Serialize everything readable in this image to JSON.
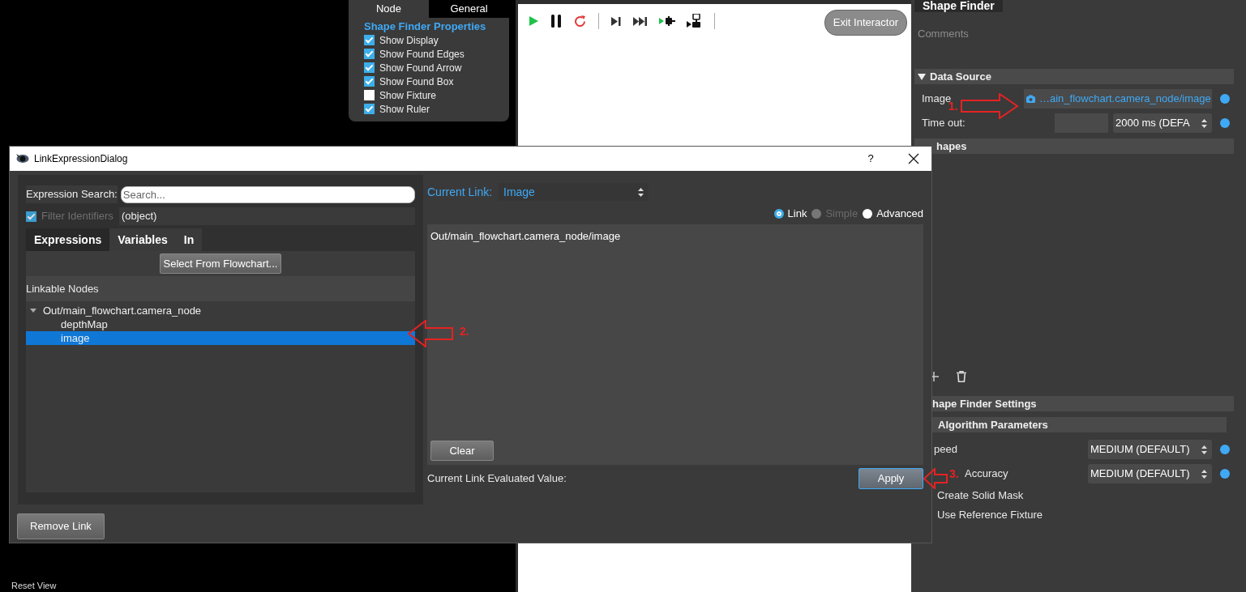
{
  "properties_panel": {
    "tabs": [
      {
        "label": "Node",
        "selected": true
      },
      {
        "label": "General",
        "selected": false
      }
    ],
    "title": "Shape Finder Properties",
    "options": [
      {
        "label": "Show Display",
        "checked": true
      },
      {
        "label": "Show Found Edges",
        "checked": true
      },
      {
        "label": "Show Found Arrow",
        "checked": true
      },
      {
        "label": "Show Found Box",
        "checked": true
      },
      {
        "label": "Show Fixture",
        "checked": false
      },
      {
        "label": "Show Ruler",
        "checked": true
      }
    ]
  },
  "reset_view": "Reset View",
  "viewer": {
    "exit_button": "Exit Interactor"
  },
  "inspector": {
    "title": "Shape Finder",
    "comments_placeholder": "Comments",
    "data_source": {
      "label": "Data Source",
      "expanded": true,
      "rows": [
        {
          "kind": "link",
          "label": "Image",
          "value": "…ain_flowchart.camera_node/image"
        },
        {
          "kind": "select",
          "label": "Time out:",
          "value": "2000 ms (DEFA"
        }
      ]
    },
    "shapes_header": "hapes",
    "settings_header": "hape Finder Settings",
    "algorithm_header": "Algorithm Parameters",
    "parameters": [
      {
        "label": "peed",
        "value": "MEDIUM (DEFAULT)"
      },
      {
        "label": "Accuracy",
        "value": "MEDIUM (DEFAULT)"
      }
    ],
    "checks": [
      {
        "label": "Create Solid Mask"
      },
      {
        "label": "Use Reference Fixture"
      }
    ]
  },
  "dialog": {
    "title": "LinkExpressionDialog",
    "help": "?",
    "search_label": "Expression Search:",
    "search_placeholder": "Search...",
    "filter": {
      "label": "Filter Identifiers",
      "checked": true
    },
    "filter_value": "(object)",
    "tabs": [
      {
        "label": "Expressions",
        "selected": true
      },
      {
        "label": "Variables",
        "selected": false
      },
      {
        "label": "In",
        "selected": false
      }
    ],
    "select_button": "Select From Flowchart...",
    "tree_header": "Linkable Nodes",
    "tree": [
      {
        "label": "Out/main_flowchart.camera_node",
        "expanded": true,
        "selected": false,
        "children": [
          {
            "label": "depthMap",
            "selected": false
          },
          {
            "label": "image",
            "selected": true
          }
        ]
      }
    ],
    "current_link_label": "Current Link:",
    "current_link_value": "Image",
    "modes": [
      {
        "label": "Link",
        "selected": true,
        "disabled": false
      },
      {
        "label": "Simple",
        "selected": false,
        "disabled": true
      },
      {
        "label": "Advanced",
        "selected": false,
        "disabled": false
      }
    ],
    "expression": "Out/main_flowchart.camera_node/image",
    "clear_button": "Clear",
    "evaluated_label": "Current Link Evaluated Value:",
    "apply_button": "Apply",
    "remove_button": "Remove Link"
  },
  "annotations": [
    {
      "label": "1.",
      "kind": "rightward"
    },
    {
      "label": "2.",
      "kind": "leftward"
    },
    {
      "label": "3.",
      "kind": "leftward"
    }
  ]
}
